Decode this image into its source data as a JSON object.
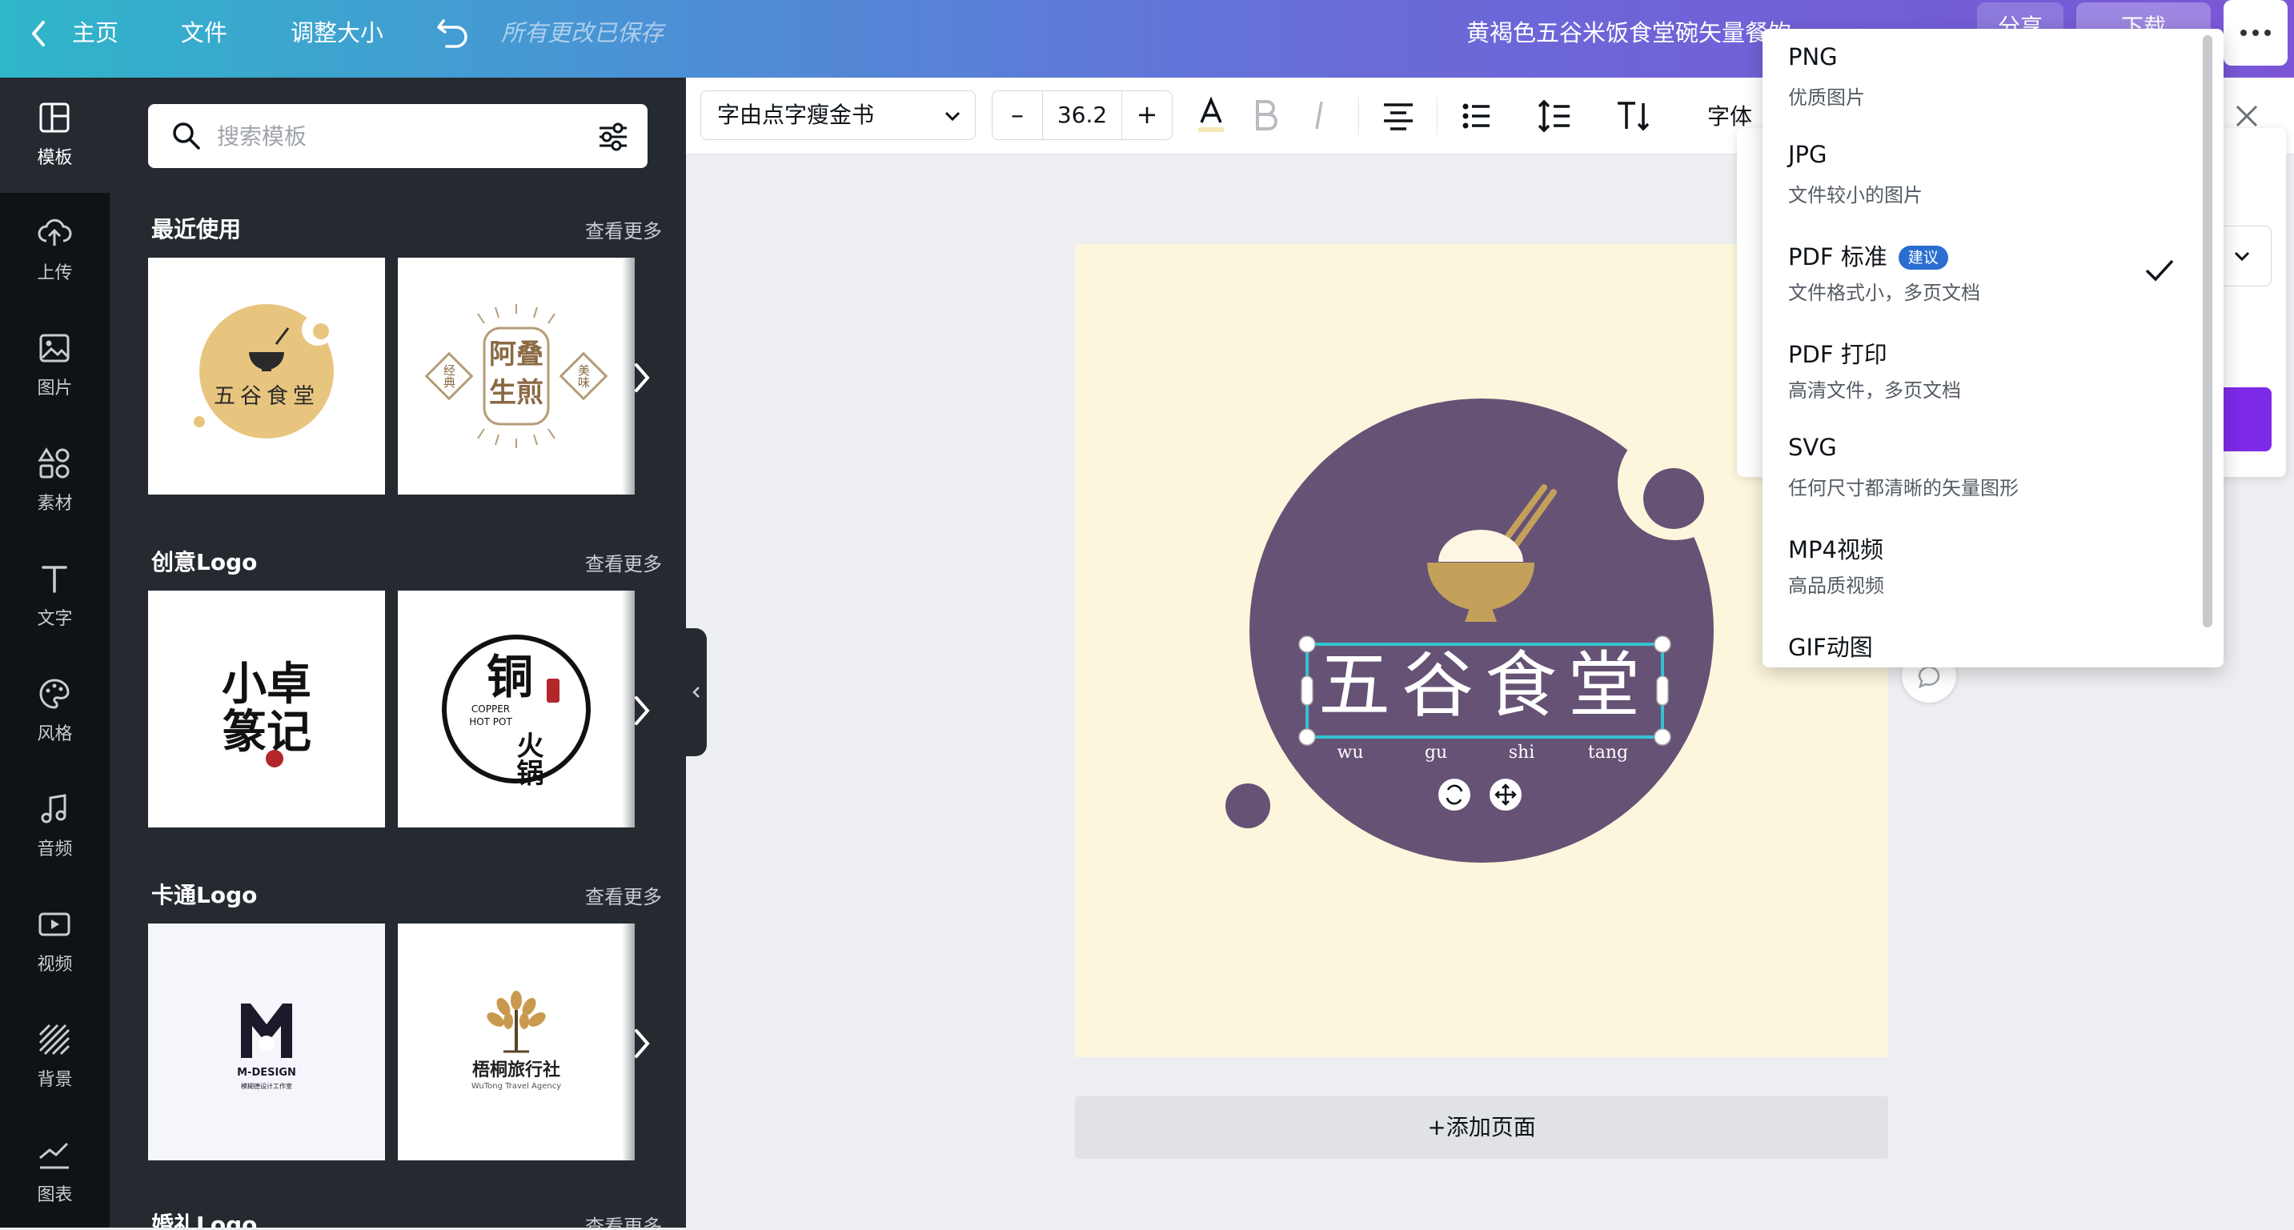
{
  "topbar": {
    "home_label": "主页",
    "file_label": "文件",
    "resize_label": "调整大小",
    "saved_status": "所有更改已保存",
    "doc_title": "黄褐色五谷米饭食堂碗矢量餐饮",
    "share_label": "分享",
    "download_label": "下载",
    "colors": {
      "gradient_start": "#2fb6c9",
      "gradient_end": "#7a56d6"
    }
  },
  "leftnav": {
    "items": [
      {
        "label": "模板",
        "icon": "template-icon"
      },
      {
        "label": "上传",
        "icon": "upload-cloud-icon"
      },
      {
        "label": "图片",
        "icon": "image-icon"
      },
      {
        "label": "素材",
        "icon": "elements-icon"
      },
      {
        "label": "文字",
        "icon": "text-icon"
      },
      {
        "label": "风格",
        "icon": "palette-icon"
      },
      {
        "label": "音频",
        "icon": "music-icon"
      },
      {
        "label": "视频",
        "icon": "video-icon"
      },
      {
        "label": "背景",
        "icon": "background-icon"
      },
      {
        "label": "图表",
        "icon": "chart-icon"
      }
    ]
  },
  "panel": {
    "search_placeholder": "搜索模板",
    "sections": [
      {
        "title": "最近使用",
        "more": "查看更多"
      },
      {
        "title": "创意Logo",
        "more": "查看更多"
      },
      {
        "title": "卡通Logo",
        "more": "查看更多"
      },
      {
        "title": "婚礼Logo",
        "more": "查看更多"
      }
    ],
    "thumbs": {
      "wugu": "五谷食堂",
      "adie_line1": "阿叠",
      "adie_line2": "生煎",
      "adie_left": "经典",
      "adie_right": "美味",
      "xiaozhuo_line1": "小卓",
      "xiaozhuo_line2": "篆记",
      "copper_en1": "COPPER",
      "copper_en2": "HOT POT",
      "copper_cn1": "铜",
      "copper_cn2": "火锅",
      "mdesign_name": "M-DESIGN",
      "mdesign_sub": "模糊德设计工作室",
      "wutong_name": "梧桐旅行社",
      "wutong_sub": "WuTong Travel Agency"
    }
  },
  "toolbar": {
    "font_name": "字由点字瘦金书",
    "font_size": "36.2",
    "minus": "–",
    "plus": "+",
    "more_label": "字体"
  },
  "canvas": {
    "logo_text": "五谷食堂",
    "pinyin": [
      "wu",
      "gu",
      "shi",
      "tang"
    ],
    "add_page": "+添加页面",
    "colors": {
      "background": "#fcf6dc",
      "circle": "#665275",
      "bowl": "#c4a15a"
    }
  },
  "download_menu": {
    "items": [
      {
        "title": "PNG",
        "sub": "优质图片",
        "badge": "",
        "selected": false
      },
      {
        "title": "JPG",
        "sub": "文件较小的图片",
        "badge": "",
        "selected": false
      },
      {
        "title": "PDF 标准",
        "sub": "文件格式小，多页文档",
        "badge": "建议",
        "selected": true
      },
      {
        "title": "PDF 打印",
        "sub": "高清文件，多页文档",
        "badge": "",
        "selected": false
      },
      {
        "title": "SVG",
        "sub": "任何尺寸都清晰的矢量图形",
        "badge": "",
        "selected": false
      },
      {
        "title": "MP4视频",
        "sub": "高品质视频",
        "badge": "",
        "selected": false
      },
      {
        "title": "GIF动图",
        "sub": "",
        "badge": "",
        "selected": false
      }
    ]
  }
}
